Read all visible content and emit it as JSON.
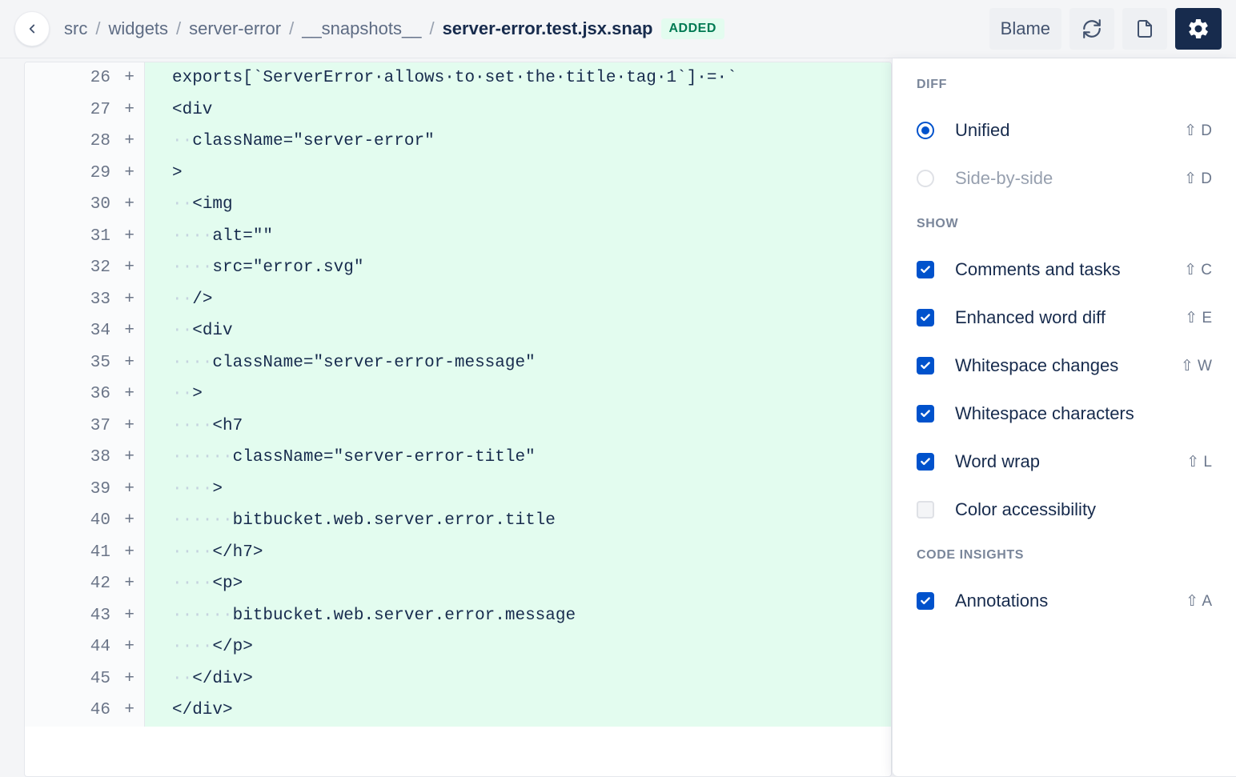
{
  "breadcrumb": [
    "src",
    "widgets",
    "server-error",
    "__snapshots__"
  ],
  "file": "server-error.test.jsx.snap",
  "badge": "ADDED",
  "toolbar": {
    "blame": "Blame"
  },
  "code": [
    {
      "ln": 26,
      "m": "+",
      "ws": "",
      "t": "exports[`ServerError·allows·to·set·the·title·tag·1`]·=·`"
    },
    {
      "ln": 27,
      "m": "+",
      "ws": "",
      "t": "<div"
    },
    {
      "ln": 28,
      "m": "+",
      "ws": "··",
      "t": "className=\"server-error\""
    },
    {
      "ln": 29,
      "m": "+",
      "ws": "",
      "t": ">"
    },
    {
      "ln": 30,
      "m": "+",
      "ws": "··",
      "t": "<img"
    },
    {
      "ln": 31,
      "m": "+",
      "ws": "····",
      "t": "alt=\"\""
    },
    {
      "ln": 32,
      "m": "+",
      "ws": "····",
      "t": "src=\"error.svg\""
    },
    {
      "ln": 33,
      "m": "+",
      "ws": "··",
      "t": "/>"
    },
    {
      "ln": 34,
      "m": "+",
      "ws": "··",
      "t": "<div"
    },
    {
      "ln": 35,
      "m": "+",
      "ws": "····",
      "t": "className=\"server-error-message\""
    },
    {
      "ln": 36,
      "m": "+",
      "ws": "··",
      "t": ">"
    },
    {
      "ln": 37,
      "m": "+",
      "ws": "····",
      "t": "<h7"
    },
    {
      "ln": 38,
      "m": "+",
      "ws": "······",
      "t": "className=\"server-error-title\""
    },
    {
      "ln": 39,
      "m": "+",
      "ws": "····",
      "t": ">"
    },
    {
      "ln": 40,
      "m": "+",
      "ws": "······",
      "t": "bitbucket.web.server.error.title"
    },
    {
      "ln": 41,
      "m": "+",
      "ws": "····",
      "t": "</h7>"
    },
    {
      "ln": 42,
      "m": "+",
      "ws": "····",
      "t": "<p>"
    },
    {
      "ln": 43,
      "m": "+",
      "ws": "······",
      "t": "bitbucket.web.server.error.message"
    },
    {
      "ln": 44,
      "m": "+",
      "ws": "····",
      "t": "</p>"
    },
    {
      "ln": 45,
      "m": "+",
      "ws": "··",
      "t": "</div>"
    },
    {
      "ln": 46,
      "m": "+",
      "ws": "",
      "t": "</div>"
    }
  ],
  "panel": {
    "diff_title": "DIFF",
    "show_title": "SHOW",
    "insights_title": "CODE INSIGHTS",
    "diff": [
      {
        "type": "radio",
        "on": true,
        "label": "Unified",
        "shortcut": "⇧ D",
        "muted": false
      },
      {
        "type": "radio",
        "on": false,
        "label": "Side-by-side",
        "shortcut": "⇧ D",
        "muted": true
      }
    ],
    "show": [
      {
        "type": "check",
        "on": true,
        "label": "Comments and tasks",
        "shortcut": "⇧ C"
      },
      {
        "type": "check",
        "on": true,
        "label": "Enhanced word diff",
        "shortcut": "⇧ E"
      },
      {
        "type": "check",
        "on": true,
        "label": "Whitespace changes",
        "shortcut": "⇧ W"
      },
      {
        "type": "check",
        "on": true,
        "label": "Whitespace characters",
        "shortcut": ""
      },
      {
        "type": "check",
        "on": true,
        "label": "Word wrap",
        "shortcut": "⇧ L"
      },
      {
        "type": "check",
        "on": false,
        "label": "Color accessibility",
        "shortcut": ""
      }
    ],
    "insights": [
      {
        "type": "check",
        "on": true,
        "label": "Annotations",
        "shortcut": "⇧ A"
      }
    ]
  }
}
